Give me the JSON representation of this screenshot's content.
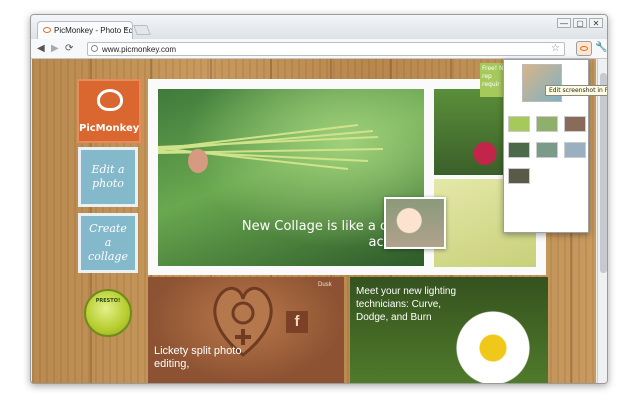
{
  "browser": {
    "tab_title": "PicMonkey - Photo Editing",
    "tab_close": "×",
    "url": "www.picmonkey.com",
    "nav_back": "◀",
    "nav_forward": "▶",
    "nav_reload": "⟳",
    "star": "☆",
    "wrench": "🔧",
    "window_controls": [
      "—",
      "▢",
      "✕"
    ],
    "extension_tooltip": "Edit screenshot in PicMonkey"
  },
  "page": {
    "logo_text": "PicMonkey",
    "edit_tile": "Edit a photo",
    "collage_tile": "Create a collage",
    "presto_badge": "PRESTO!",
    "hero_headline": "New Collage is like a circus acrobat",
    "bottom_left": {
      "credit": "Dusk",
      "text": "Lickety split photo editing,",
      "fb_letter": "f"
    },
    "bottom_right_text": "Meet your new lighting technicians: Curve, Dodge, and Burn",
    "green_note": "Free! No rep requir"
  },
  "colors": {
    "accent_orange": "#d9672f",
    "tile_blue": "#83b9cb",
    "presto_green": "#b6cc2e"
  },
  "icons": [
    "picmonkey-favicon",
    "back-arrow-icon",
    "forward-arrow-icon",
    "reload-icon",
    "star-icon",
    "picmonkey-extension-icon",
    "wrench-icon",
    "monkey-logo-icon",
    "facebook-icon"
  ]
}
